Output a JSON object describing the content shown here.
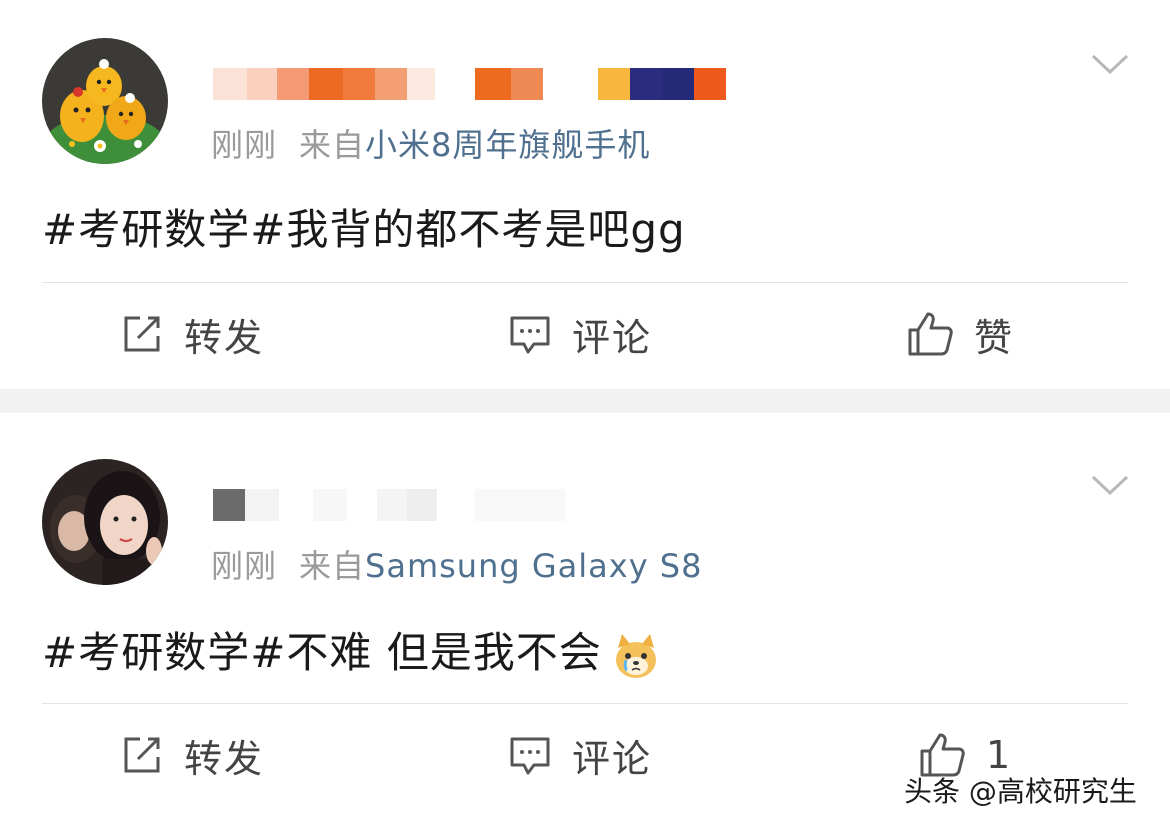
{
  "posts": [
    {
      "time": "刚刚",
      "from_prefix": "来自",
      "source": "小米8周年旗舰手机",
      "content": "#考研数学#我背的都不考是吧gg",
      "actions": {
        "repost_label": "转发",
        "comment_label": "评论",
        "like_label": "赞"
      }
    },
    {
      "time": "刚刚",
      "from_prefix": "来自",
      "source": "Samsung Galaxy S8",
      "content": "#考研数学#不难 但是我不会",
      "emoji": "dog-crying-emoji",
      "actions": {
        "repost_label": "转发",
        "comment_label": "评论",
        "like_count": "1"
      }
    }
  ],
  "watermark": "头条 @高校研究生",
  "colors": {
    "source_link": "#50708f",
    "meta_gray": "#9a9a9a",
    "separator": "#f2f2f2"
  }
}
